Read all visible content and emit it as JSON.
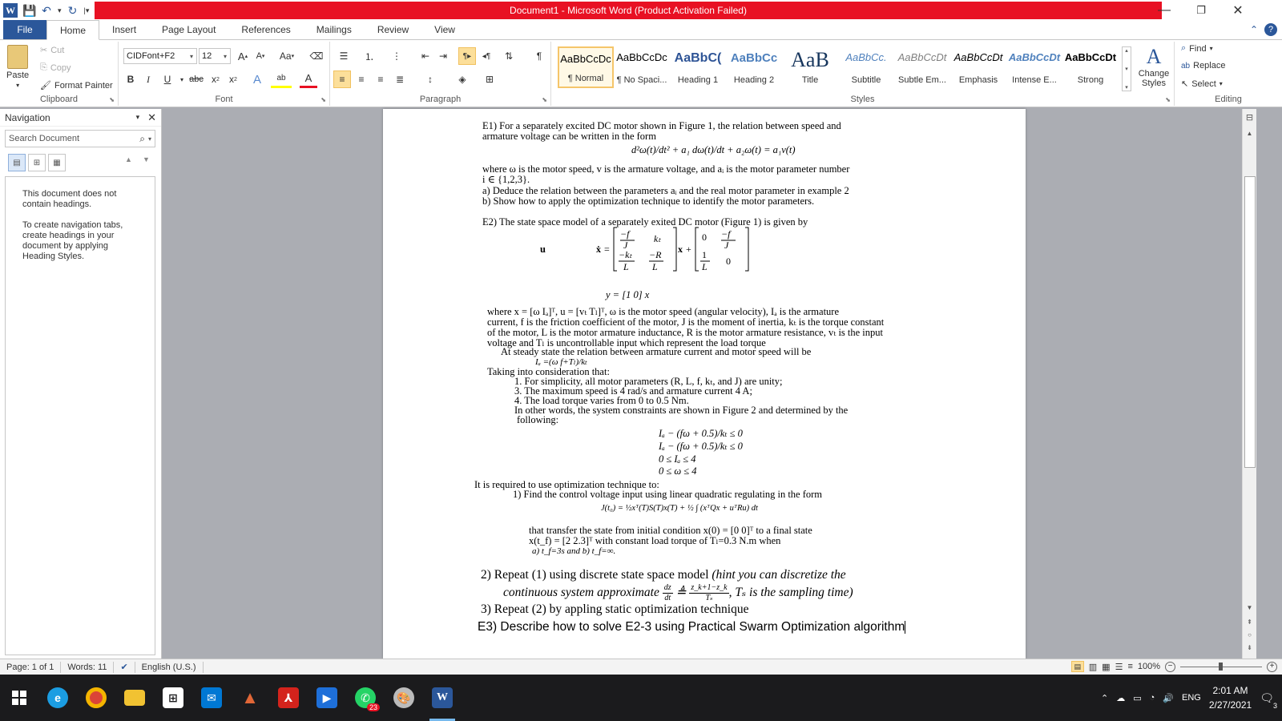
{
  "window": {
    "title": "Document1  -  Microsoft Word (Product Activation Failed)",
    "app_icon": "W"
  },
  "qat": {
    "save_icon": "💾",
    "undo_icon": "↶",
    "redo_icon": "↻"
  },
  "tabs": [
    "File",
    "Home",
    "Insert",
    "Page Layout",
    "References",
    "Mailings",
    "Review",
    "View"
  ],
  "ribbon": {
    "clipboard": {
      "paste": "Paste",
      "cut": "Cut",
      "copy": "Copy",
      "format_painter": "Format Painter",
      "label": "Clipboard"
    },
    "font": {
      "name": "CIDFont+F2",
      "size": "12",
      "label": "Font",
      "grow": "A",
      "shrink": "A",
      "case": "Aa",
      "bold": "B",
      "italic": "I",
      "underline": "U",
      "strike": "abc",
      "sub": "x",
      "sup": "x",
      "effects": "A",
      "highlight": "ab",
      "color": "A"
    },
    "paragraph": {
      "label": "Paragraph"
    },
    "styles": {
      "label": "Styles",
      "items": [
        {
          "sample": "AaBbCcDc",
          "name": "¶ Normal"
        },
        {
          "sample": "AaBbCcDc",
          "name": "¶ No Spaci..."
        },
        {
          "sample": "AaBbC(",
          "name": "Heading 1"
        },
        {
          "sample": "AaBbCc",
          "name": "Heading 2"
        },
        {
          "sample": "AaB",
          "name": "Title"
        },
        {
          "sample": "AaBbCc.",
          "name": "Subtitle"
        },
        {
          "sample": "AaBbCcDt",
          "name": "Subtle Em..."
        },
        {
          "sample": "AaBbCcDt",
          "name": "Emphasis"
        },
        {
          "sample": "AaBbCcDt",
          "name": "Intense E..."
        },
        {
          "sample": "AaBbCcDt",
          "name": "Strong"
        }
      ],
      "change_styles": "Change Styles"
    },
    "editing": {
      "label": "Editing",
      "find": "Find",
      "replace": "Replace",
      "select": "Select"
    }
  },
  "navigation": {
    "title": "Navigation",
    "search_placeholder": "Search Document",
    "msg1": "This document does not contain headings.",
    "msg2": "To create navigation tabs, create headings in your document by applying Heading Styles."
  },
  "document": {
    "e1_l1": "E1) For a separately excited DC motor shown in Figure 1, the relation between speed and",
    "e1_l2": "armature voltage can be written in the form",
    "e1_eq": "d²ω(t)/dt² + a₁ dω(t)/dt + a₂ω(t) = a₁v(t)",
    "e1_l3": "where ω is the motor speed, v  is the armature voltage, and aᵢ is the motor parameter number",
    "e1_l4": "i ∈ {1,2,3}.",
    "e1_a": "a)   Deduce the relation between the parameters aᵢ and the real motor parameter in example 2",
    "e1_b": "b)   Show how to apply the optimization technique to identify the motor parameters.",
    "e2_l1": "E2) The state space model of a separately exited DC motor (Figure 1) is given by",
    "e2_yeq": "y = [1   0] x",
    "e2_w1": "where x = [ω   Iₐ]ᵀ,   u = [vₜ   Tₗ]ᵀ, ω is the motor speed (angular velocity), Iₐ is the armature",
    "e2_w2": "current, f is the friction coefficient of the motor, J is the moment of inertia, kₜ is the torque constant",
    "e2_w3": "of the motor, L is the motor armature inductance, R is the motor armature resistance, vₜ is the input",
    "e2_w4": "voltage and Tₗ is uncontrollable input which represent the load torque",
    "e2_ss": "At steady state the relation between armature current and motor speed will be",
    "e2_ia": "Iₐ =(ω f+Tₗ)/kₜ",
    "e2_take": "Taking into consideration that:",
    "e2_c1": "1.  For simplicity, all motor parameters (R, L, f, kₜ, and J) are unity;",
    "e2_c3": "3. The maximum speed is 4 rad/s and armature current 4 A;",
    "e2_c4": "4. The load torque varies from 0 to 0.5 Nm.",
    "e2_ow1": "In other words, the system constraints are shown in Figure 2 and determined by the",
    "e2_ow2": "following:",
    "con1": "Iₐ − (fω + 0.5)/kₜ ≤ 0",
    "con2": "Iₐ − (fω + 0.5)/kₜ ≤ 0",
    "con3": "0 ≤ Iₐ ≤ 4",
    "con4": "0 ≤ ω ≤ 4",
    "req": "It is required to use optimization technique to:",
    "q1": "1)   Find the control voltage input using linear quadratic regulating in the form",
    "j_eq": "J(t₀) = ½xᵀ(T)S(T)x(T) + ½ ∫ (xᵀQx + uᵀRu) dt",
    "tr1": "that transfer the state from initial condition x(0) = [0    0]ᵀ  to a final state",
    "tr2": "x(t_f) = [2    2.3]ᵀ  with constant load torque of Tₗ=0.3 N.m when",
    "tr3": "a) t_f=3s and b) t_f=∞.",
    "q2a": "2)   Repeat (1) using discrete state space model ",
    "q2b": "(hint you can discretize the",
    "q2c": "continuous system approximate ",
    "q2d": ", Tₛ is the sampling time)",
    "q2_frac_n1": "dz",
    "q2_frac_d1": "dt",
    "q2_frac_n2": "z_k+1−z_k",
    "q2_frac_d2": "Tₛ",
    "q2_sym": "≜",
    "q3": "3)    Repeat (2) by appling static optimization technique",
    "e3": "E3) Describe how to solve E2-3 using Practical Swarm Optimization algorithm"
  },
  "status": {
    "page": "Page: 1 of 1",
    "words": "Words: 11",
    "lang": "English (U.S.)",
    "zoom": "100%"
  },
  "tray": {
    "lang": "ENG",
    "time": "2:01 AM",
    "date": "2/27/2021",
    "notif": "3",
    "whatsapp_badge": "23"
  }
}
